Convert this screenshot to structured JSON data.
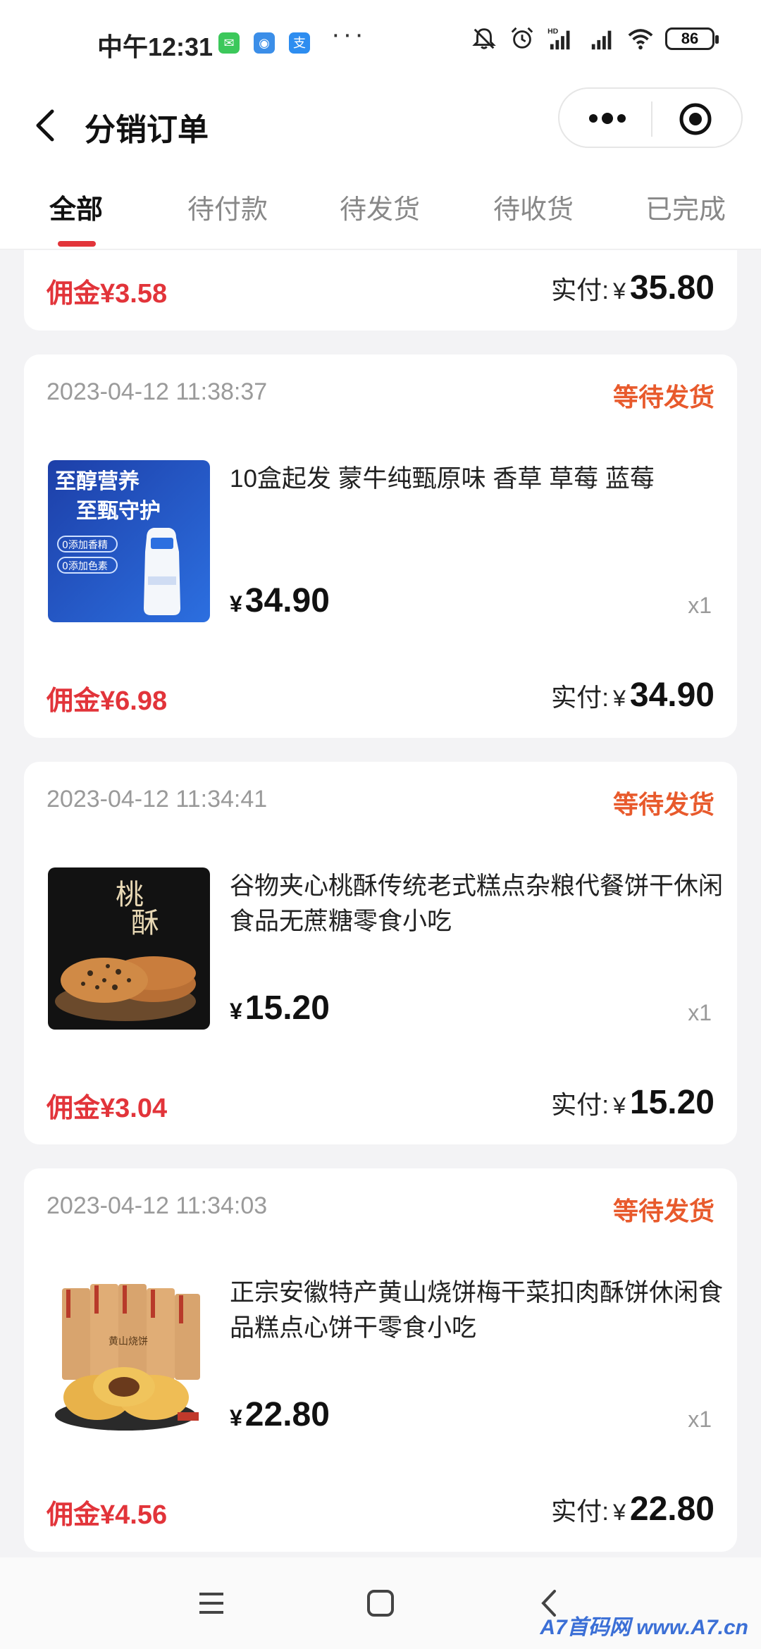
{
  "status_bar": {
    "time": "中午12:31",
    "battery": "86",
    "app_icons": [
      "wechat-icon",
      "browser-icon",
      "alipay-icon"
    ],
    "alipay_glyph": "支",
    "dots": "···"
  },
  "header": {
    "title": "分销订单"
  },
  "tabs": [
    {
      "label": "全部",
      "active": true
    },
    {
      "label": "待付款",
      "active": false
    },
    {
      "label": "待发货",
      "active": false
    },
    {
      "label": "待收货",
      "active": false
    },
    {
      "label": "已完成",
      "active": false
    }
  ],
  "labels": {
    "commission_prefix": "佣金",
    "paid_label": "实付:",
    "currency": "¥"
  },
  "partial_order": {
    "commission": "¥3.58",
    "paid": "35.80"
  },
  "orders": [
    {
      "time": "2023-04-12 11:38:37",
      "status": "等待发货",
      "title": "10盒起发 蒙牛纯甄原味 香草 草莓 蓝莓",
      "price": "34.90",
      "qty": "x1",
      "commission": "¥6.98",
      "paid": "34.90",
      "thumb_text": [
        "至醇营养",
        "至甄守护",
        "0添加香精",
        "0添加色素"
      ]
    },
    {
      "time": "2023-04-12 11:34:41",
      "status": "等待发货",
      "title": "谷物夹心桃酥传统老式糕点杂粮代餐饼干休闲食品无蔗糖零食小吃",
      "price": "15.20",
      "qty": "x1",
      "commission": "¥3.04",
      "paid": "15.20",
      "thumb_text": [
        "桃",
        "酥"
      ]
    },
    {
      "time": "2023-04-12 11:34:03",
      "status": "等待发货",
      "title": "正宗安徽特产黄山烧饼梅干菜扣肉酥饼休闲食品糕点心饼干零食小吃",
      "price": "22.80",
      "qty": "x1",
      "commission": "¥4.56",
      "paid": "22.80",
      "thumb_text": [
        "黄山烧饼"
      ]
    }
  ],
  "watermark": "A7首码网  www.A7.cn",
  "colors": {
    "accent_red": "#e2343a",
    "status_orange": "#e85a2c",
    "background": "#f3f3f5"
  }
}
